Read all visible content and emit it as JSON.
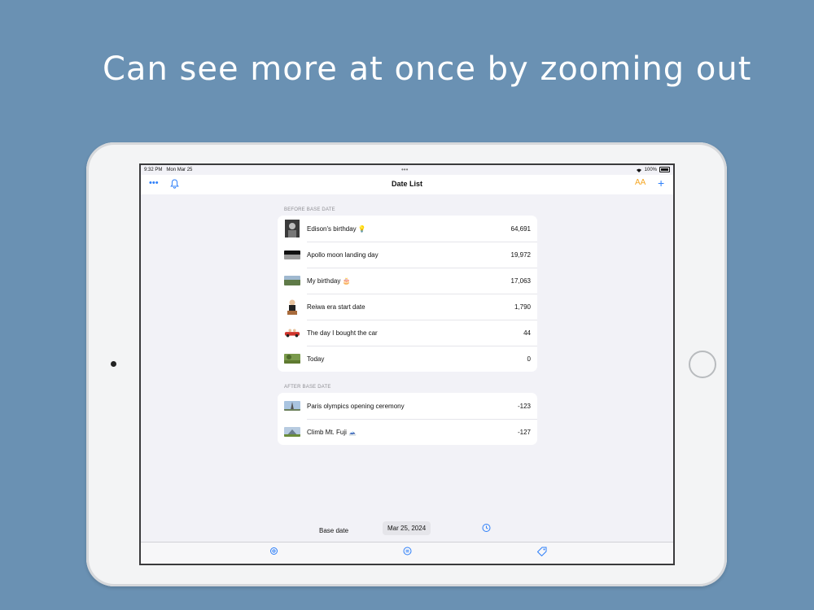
{
  "headline": "Can see more at once by zooming out",
  "status": {
    "time": "9:32 PM",
    "date": "Mon Mar 25",
    "battery": "100%"
  },
  "navbar": {
    "title": "Date List",
    "text_size_label": "AA"
  },
  "sections": [
    {
      "header": "BEFORE BASE DATE",
      "rows": [
        {
          "label": "Edison's birthday 💡",
          "value": "64,691"
        },
        {
          "label": "Apollo moon landing day",
          "value": "19,972"
        },
        {
          "label": "My birthday 🎂",
          "value": "17,063"
        },
        {
          "label": "Reiwa era start date",
          "value": "1,790"
        },
        {
          "label": "The day I bought the car",
          "value": "44"
        },
        {
          "label": "Today",
          "value": "0"
        }
      ]
    },
    {
      "header": "AFTER BASE DATE",
      "rows": [
        {
          "label": "Paris olympics opening ceremony",
          "value": "-123"
        },
        {
          "label": "Climb Mt. Fuji 🗻",
          "value": "-127"
        }
      ]
    }
  ],
  "base": {
    "label": "Base date",
    "date": "Mar 25, 2024"
  },
  "colors": {
    "accent": "#2d7ff9",
    "orange": "#f5a623",
    "background": "#6a91b3"
  },
  "icons": {
    "more": "ellipsis-icon",
    "bell": "bell-icon",
    "text_size": "text-size-icon",
    "add": "plus-icon",
    "history": "history-icon",
    "settings": "gear-icon",
    "convert": "swap-icon",
    "tag": "tag-icon"
  }
}
